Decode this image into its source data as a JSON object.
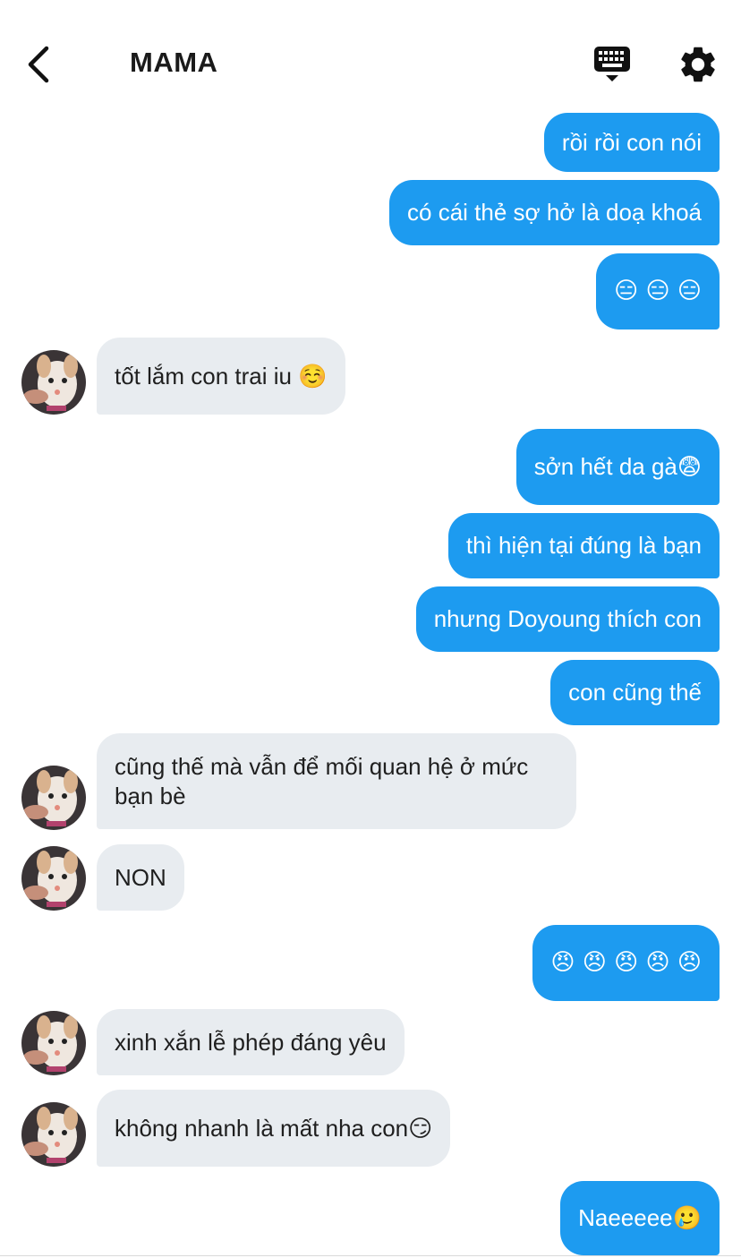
{
  "header": {
    "title": "MAMA"
  },
  "messages": [
    {
      "dir": "out",
      "text": "rồi rồi con nói"
    },
    {
      "dir": "out",
      "text": "có cái thẻ sợ hở là doạ khoá"
    },
    {
      "dir": "out",
      "text": "😑 😑 😑"
    },
    {
      "dir": "in",
      "text": "tốt lắm con trai iu ☺️"
    },
    {
      "dir": "out",
      "text": "sởn hết da gà😨"
    },
    {
      "dir": "out",
      "text": "thì hiện tại đúng là bạn"
    },
    {
      "dir": "out",
      "text": "nhưng Doyoung thích con"
    },
    {
      "dir": "out",
      "text": "con cũng thế"
    },
    {
      "dir": "in",
      "text": "cũng thế mà vẫn để mối quan hệ ở mức bạn bè"
    },
    {
      "dir": "in",
      "text": "NON"
    },
    {
      "dir": "out",
      "text": "😠 😠 😠 😠 😠"
    },
    {
      "dir": "in",
      "text": "xinh xắn lễ phép đáng yêu"
    },
    {
      "dir": "in",
      "text": "không nhanh là mất nha con😏"
    },
    {
      "dir": "out",
      "text": "Naeeeee🥲"
    }
  ],
  "colors": {
    "outgoing_bubble": "#1d9bf0",
    "incoming_bubble": "#e8ecf0"
  },
  "icons": {
    "back": "chevron-left-icon",
    "keyboard": "keyboard-icon",
    "settings": "gear-icon",
    "avatar": "dog-avatar"
  }
}
